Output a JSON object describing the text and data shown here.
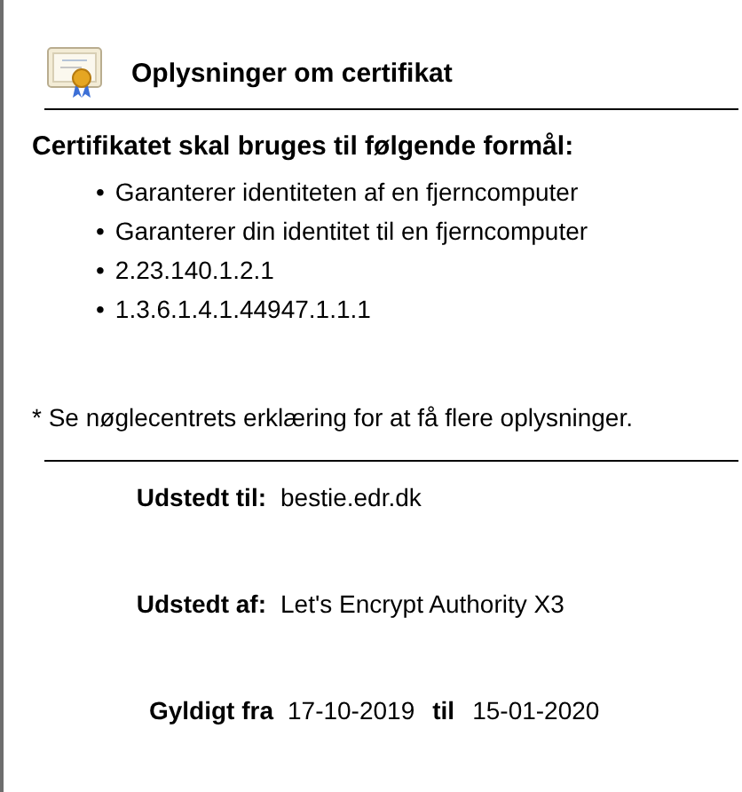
{
  "title": "Oplysninger om certifikat",
  "purposes_heading": "Certifikatet skal bruges til følgende formål:",
  "purposes": [
    "Garanterer identiteten af en fjerncomputer",
    "Garanterer din identitet til en fjerncomputer",
    "2.23.140.1.2.1",
    "1.3.6.1.4.1.44947.1.1.1"
  ],
  "bullet": "•",
  "note": "* Se nøglecentrets erklæring for at få flere oplysninger.",
  "issued_to": {
    "label": "Udstedt til:",
    "value": "bestie.edr.dk"
  },
  "issued_by": {
    "label": "Udstedt af:",
    "value": "Let's Encrypt Authority X3"
  },
  "validity": {
    "label": "Gyldigt fra",
    "from": "17-10-2019",
    "to_label": "til",
    "to": "15-01-2020"
  }
}
